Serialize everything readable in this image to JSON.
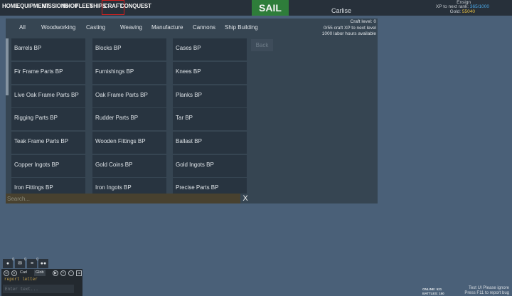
{
  "nav": {
    "items": [
      "HOME",
      "EQUIPMENT",
      "MISSIONS",
      "SHOP",
      "FLEET",
      "SHIPS",
      "CRAFT",
      "CONQUEST"
    ],
    "active": "CRAFT",
    "sail_label": "SAIL",
    "city": "Carlise"
  },
  "player": {
    "rank": "Ensign",
    "xp_label": "XP to next rank:",
    "xp_value": "365/1000",
    "gold_label": "Gold:",
    "gold_value": "55040"
  },
  "craft": {
    "tabs": [
      "All",
      "Woodworking",
      "Casting",
      "Weaving",
      "Manufacture",
      "Cannons",
      "Ship Building"
    ],
    "info": {
      "level": "Craft level: 0",
      "xp": "0/55 craft XP to next level",
      "labor": "1000 labor hours available"
    },
    "back_label": "Back",
    "items": [
      "Barrels BP",
      "Blocks BP",
      "Cases BP",
      "Fir Frame Parts BP",
      "Furnishings BP",
      "Knees BP",
      "Live Oak Frame Parts BP",
      "Oak Frame Parts BP",
      "Planks BP",
      "Rigging Parts BP",
      "Rudder Parts BP",
      "Tar BP",
      "Teak Frame Parts BP",
      "Wooden Fittings BP",
      "Ballast BP",
      "Copper Ingots BP",
      "Gold Coins BP",
      "Gold Ingots BP",
      "Iron Fittings BP",
      "Iron Ingots BP",
      "Precise Parts BP"
    ],
    "search_placeholder": "Search...",
    "clear_label": "X"
  },
  "chat": {
    "badges": [
      "0",
      "0",
      "0"
    ],
    "channel_user": "Carl",
    "channel_global": "Glob",
    "last_message": "report letter",
    "input_placeholder": "Enter text..."
  },
  "footer": {
    "online": "ONLINE: 521",
    "battles": "BATTLES: 150",
    "test_line1": "Test UI Please ignore",
    "test_line2": "Press F11 to report bug"
  }
}
